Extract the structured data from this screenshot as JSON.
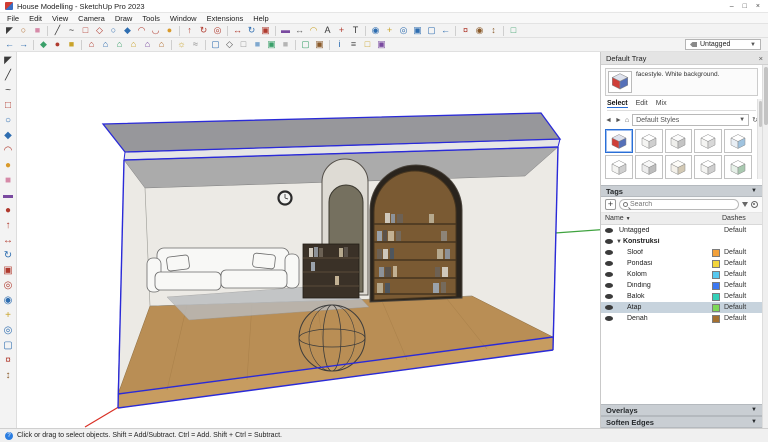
{
  "window": {
    "title": "House Modelling - SketchUp Pro 2023",
    "controls": {
      "minimize": "–",
      "maximize": "□",
      "close": "×"
    }
  },
  "menu": {
    "items": [
      "File",
      "Edit",
      "View",
      "Camera",
      "Draw",
      "Tools",
      "Window",
      "Extensions",
      "Help"
    ]
  },
  "toolbars": {
    "tag_filter": {
      "value": "Untagged"
    },
    "row1": [
      [
        "select-tool-icon",
        "◤",
        "#3a3a3a"
      ],
      [
        "lasso-select-icon",
        "○",
        "#b06a2a"
      ],
      [
        "eraser-tool-icon",
        "■",
        "#d68aa8"
      ],
      [
        "sep"
      ],
      [
        "line-tool-icon",
        "╱",
        "#333333"
      ],
      [
        "freehand-tool-icon",
        "~",
        "#333333"
      ],
      [
        "rectangle-tool-icon",
        "□",
        "#b03a2e"
      ],
      [
        "rotated-rectangle-icon",
        "◇",
        "#b03a2e"
      ],
      [
        "circle-tool-icon",
        "○",
        "#2e6db0"
      ],
      [
        "polygon-tool-icon",
        "◆",
        "#2e6db0"
      ],
      [
        "arc-tool-icon",
        "◠",
        "#b03a2e"
      ],
      [
        "two-point-arc-icon",
        "◡",
        "#b03a2e"
      ],
      [
        "pie-tool-icon",
        "●",
        "#d99a2b"
      ],
      [
        "sep"
      ],
      [
        "push-pull-icon",
        "↑",
        "#b03a2e"
      ],
      [
        "follow-me-icon",
        "↻",
        "#b03a2e"
      ],
      [
        "offset-tool-icon",
        "◎",
        "#b03a2e"
      ],
      [
        "sep"
      ],
      [
        "move-tool-icon",
        "↔",
        "#b03a2e"
      ],
      [
        "rotate-tool-icon",
        "↻",
        "#2e6db0"
      ],
      [
        "scale-tool-icon",
        "▣",
        "#b03a2e"
      ],
      [
        "sep"
      ],
      [
        "tape-measure-icon",
        "▬",
        "#7a4aa0"
      ],
      [
        "dimension-tool-icon",
        "↔",
        "#666666"
      ],
      [
        "protractor-tool-icon",
        "◠",
        "#c9a32a"
      ],
      [
        "text-tool-icon",
        "A",
        "#3a3a3a"
      ],
      [
        "axes-tool-icon",
        "+",
        "#b03a2e"
      ],
      [
        "3d-text-tool-icon",
        "T",
        "#3a3a3a"
      ],
      [
        "sep"
      ],
      [
        "orbit-tool-icon",
        "◉",
        "#2e6db0"
      ],
      [
        "pan-tool-icon",
        "+",
        "#c9a32a"
      ],
      [
        "zoom-tool-icon",
        "◎",
        "#2e6db0"
      ],
      [
        "zoom-window-icon",
        "▣",
        "#2e6db0"
      ],
      [
        "zoom-extents-icon",
        "▢",
        "#2e6db0"
      ],
      [
        "previous-view-icon",
        "←",
        "#2e6db0"
      ],
      [
        "sep"
      ],
      [
        "position-camera-icon",
        "¤",
        "#b03a2e"
      ],
      [
        "look-around-icon",
        "◉",
        "#8a5a2a"
      ],
      [
        "walk-tool-icon",
        "↕",
        "#8a5a2a"
      ],
      [
        "sep"
      ],
      [
        "section-plane-icon",
        "□",
        "#3aa06a"
      ]
    ],
    "row2": [
      [
        "undo-icon",
        "←",
        "#2e6db0"
      ],
      [
        "redo-icon",
        "→",
        "#2e6db0"
      ],
      [
        "sep"
      ],
      [
        "make-component-icon",
        "◆",
        "#3aa06a"
      ],
      [
        "paint-bucket-icon",
        "●",
        "#b03a2e"
      ],
      [
        "materials-icon",
        "■",
        "#c9a32a"
      ],
      [
        "sep"
      ],
      [
        "iso-view-icon",
        "⌂",
        "#b03a2e"
      ],
      [
        "top-view-icon",
        "⌂",
        "#2e6db0"
      ],
      [
        "front-view-icon",
        "⌂",
        "#3aa06a"
      ],
      [
        "right-view-icon",
        "⌂",
        "#c9a32a"
      ],
      [
        "back-view-icon",
        "⌂",
        "#7a4aa0"
      ],
      [
        "left-view-icon",
        "⌂",
        "#b06a2a"
      ],
      [
        "sep"
      ],
      [
        "shadows-toggle-icon",
        "☼",
        "#c9a32a"
      ],
      [
        "fog-toggle-icon",
        "≈",
        "#8a8a8a"
      ],
      [
        "sep"
      ],
      [
        "x-ray-mode-icon",
        "▢",
        "#2e6db0"
      ],
      [
        "wireframe-mode-icon",
        "◇",
        "#555555"
      ],
      [
        "hidden-line-mode-icon",
        "□",
        "#8a8a8a"
      ],
      [
        "shaded-mode-icon",
        "■",
        "#7fa8cf"
      ],
      [
        "textured-mode-icon",
        "▣",
        "#3aa06a"
      ],
      [
        "monochrome-mode-icon",
        "■",
        "#b5b5b5"
      ],
      [
        "sep"
      ],
      [
        "section-display-icon",
        "▢",
        "#3aa06a"
      ],
      [
        "section-cuts-icon",
        "▣",
        "#8a5a2a"
      ],
      [
        "sep"
      ],
      [
        "entity-info-icon",
        "i",
        "#2e6db0"
      ],
      [
        "outliner-icon",
        "≡",
        "#555555"
      ],
      [
        "scenes-icon",
        "□",
        "#c9a32a"
      ],
      [
        "styles-panel-icon",
        "▣",
        "#7a4aa0"
      ]
    ],
    "left": [
      [
        "select-tool-icon",
        "◤",
        "#3a3a3a"
      ],
      [
        "line-tool-icon",
        "╱",
        "#333333"
      ],
      [
        "freehand-tool-icon",
        "~",
        "#333333"
      ],
      [
        "rectangle-tool-icon",
        "□",
        "#b03a2e"
      ],
      [
        "circle-tool-icon",
        "○",
        "#2e6db0"
      ],
      [
        "polygon-tool-icon",
        "◆",
        "#2e6db0"
      ],
      [
        "arc-tool-icon",
        "◠",
        "#b03a2e"
      ],
      [
        "pie-tool-icon",
        "●",
        "#d99a2b"
      ],
      [
        "eraser-tool-icon",
        "■",
        "#d68aa8"
      ],
      [
        "tape-measure-icon",
        "▬",
        "#7a4aa0"
      ],
      [
        "paint-bucket-icon",
        "●",
        "#b03a2e"
      ],
      [
        "push-pull-icon",
        "↑",
        "#b03a2e"
      ],
      [
        "move-tool-icon",
        "↔",
        "#b03a2e"
      ],
      [
        "rotate-tool-icon",
        "↻",
        "#2e6db0"
      ],
      [
        "scale-tool-icon",
        "▣",
        "#b03a2e"
      ],
      [
        "offset-tool-icon",
        "◎",
        "#b03a2e"
      ],
      [
        "orbit-tool-icon",
        "◉",
        "#2e6db0"
      ],
      [
        "pan-tool-icon",
        "+",
        "#c9a32a"
      ],
      [
        "zoom-tool-icon",
        "◎",
        "#2e6db0"
      ],
      [
        "zoom-extents-icon",
        "▢",
        "#2e6db0"
      ],
      [
        "position-camera-icon",
        "¤",
        "#b03a2e"
      ],
      [
        "walk-tool-icon",
        "↕",
        "#8a5a2a"
      ]
    ]
  },
  "viewport": {
    "selection_color": "#2a2ad8",
    "axis_red": "#d93025",
    "axis_green": "#3fa33f"
  },
  "tray": {
    "title": "Default Tray",
    "styles": {
      "description": "facestyle. White background.",
      "tabs": [
        "Select",
        "Edit",
        "Mix"
      ],
      "active_tab": "Select",
      "dropdown_value": "Default Styles",
      "thumbnails": [
        {
          "face": "#cf3f38",
          "top": "#dfe3ee",
          "side": "#5570b8",
          "selected": true
        },
        {
          "face": "#f4f4f2",
          "top": "#ffffff",
          "side": "#cfcfcf",
          "selected": false
        },
        {
          "face": "#efefec",
          "top": "#fbfbfb",
          "side": "#c4c4c4",
          "selected": false
        },
        {
          "face": "#f4f4f2",
          "top": "#ffffff",
          "side": "#d8d8d8",
          "selected": false
        },
        {
          "face": "#e8eef4",
          "top": "#ffffff",
          "side": "#9fc3df",
          "selected": false
        },
        {
          "face": "#f4f4f2",
          "top": "#ffffff",
          "side": "#cfcfcf",
          "selected": false
        },
        {
          "face": "#ececec",
          "top": "#f8f8f8",
          "side": "#bdbdbd",
          "selected": false
        },
        {
          "face": "#f4f1ea",
          "top": "#fdfcf8",
          "side": "#d3c9b4",
          "selected": false
        },
        {
          "face": "#f4f4f2",
          "top": "#ffffff",
          "side": "#cfcfcf",
          "selected": false
        },
        {
          "face": "#e6f0e8",
          "top": "#ffffff",
          "side": "#a9c9b0",
          "selected": false
        }
      ]
    },
    "tags": {
      "title": "Tags",
      "search_placeholder": "Search",
      "name_column": "Name",
      "dashes_column": "Dashes",
      "rows": [
        {
          "name": "Untagged",
          "dashes": "Default",
          "color": null,
          "visible": true,
          "indent": 0,
          "group": false,
          "selected": false
        },
        {
          "name": "Konstruksi",
          "dashes": "",
          "color": null,
          "visible": true,
          "indent": 0,
          "group": true,
          "selected": false
        },
        {
          "name": "Sloof",
          "dashes": "Default",
          "color": "#f2a13c",
          "visible": true,
          "indent": 1,
          "group": false,
          "selected": false
        },
        {
          "name": "Pondasi",
          "dashes": "Default",
          "color": "#f2d53c",
          "visible": true,
          "indent": 1,
          "group": false,
          "selected": false
        },
        {
          "name": "Kolom",
          "dashes": "Default",
          "color": "#57c8ef",
          "visible": true,
          "indent": 1,
          "group": false,
          "selected": false
        },
        {
          "name": "Dinding",
          "dashes": "Default",
          "color": "#3c78f2",
          "visible": true,
          "indent": 1,
          "group": false,
          "selected": false
        },
        {
          "name": "Balok",
          "dashes": "Default",
          "color": "#35d0b8",
          "visible": true,
          "indent": 1,
          "group": false,
          "selected": false
        },
        {
          "name": "Atap",
          "dashes": "Default",
          "color": "#7ed957",
          "visible": true,
          "indent": 1,
          "group": false,
          "selected": true
        },
        {
          "name": "Denah",
          "dashes": "Default",
          "color": "#a5702f",
          "visible": true,
          "indent": 1,
          "group": false,
          "selected": false
        }
      ]
    },
    "overlays_title": "Overlays",
    "soften_title": "Soften Edges"
  },
  "status": {
    "message": "Click or drag to select objects. Shift = Add/Subtract. Ctrl = Add. Shift + Ctrl = Subtract."
  }
}
